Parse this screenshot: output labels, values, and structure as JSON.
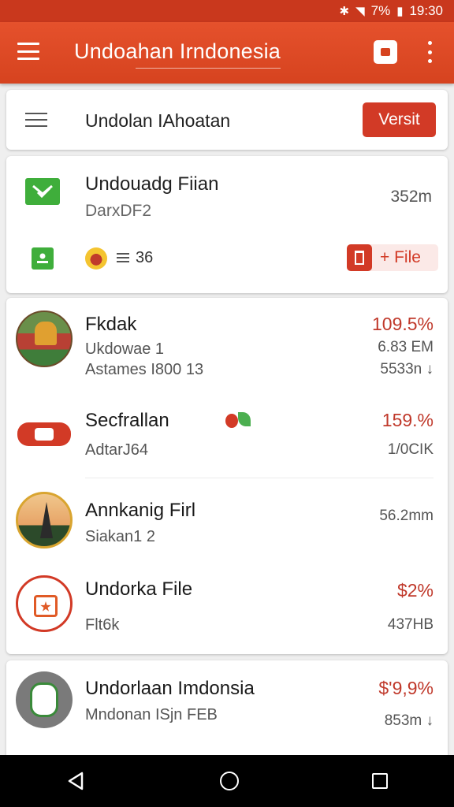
{
  "status_bar": {
    "battery": "7%",
    "time": "19:30"
  },
  "app_bar": {
    "title": "Undoahan Irndonesia"
  },
  "filter": {
    "label": "Undolan IAhoatan",
    "button_label": "Versit"
  },
  "file_card": {
    "title": "Undouadg Fiian",
    "subtitle": "DarxDF2",
    "size": "352m",
    "count": "36",
    "file_button_label": "+ File"
  },
  "list": [
    {
      "name": "Fkdak",
      "sub1": "Ukdowae 1",
      "sub2": "Astames I800 13",
      "pct": "109.5%",
      "meta1": "6.83 EM",
      "meta2": "5533n ↓"
    },
    {
      "name": "Secfrallan",
      "sub1": "AdtarJ64",
      "pct": "159.%",
      "meta1": "1/0CIK"
    },
    {
      "name": "Annkanig Firl",
      "sub1": "Siakan1 2",
      "meta1": "56.2mm"
    },
    {
      "name": "Undorka File",
      "sub1": "Flt6k",
      "pct": "$2%",
      "meta1": "437HB"
    }
  ],
  "last_item": {
    "name": "Undorlaan Imdonsia",
    "sub1": "Mndonan ISjn FEB",
    "pct": "$'9,9%",
    "meta1": "853m ↓"
  },
  "colors": {
    "primary": "#d6431f",
    "accent": "#d23a26",
    "green": "#3fae3b"
  }
}
